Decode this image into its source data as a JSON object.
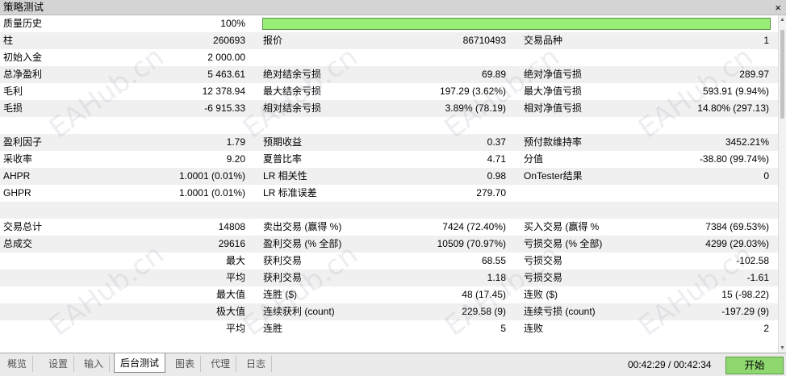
{
  "window": {
    "title": "策略测试",
    "close_glyph": "×"
  },
  "watermark": "EAHub.cn",
  "quality": {
    "label": "质量历史",
    "value": "100%",
    "fraction": 1.0
  },
  "rows": [
    {
      "c1": "柱",
      "v1": "260693",
      "c2": "报价",
      "v2": "86710493",
      "c3": "交易品种",
      "v3": "1"
    },
    {
      "c1": "初始入金",
      "v1": "2 000.00",
      "c2": "",
      "v2": "",
      "c3": "",
      "v3": ""
    },
    {
      "c1": "总净盈利",
      "v1": "5 463.61",
      "c2": "绝对结余亏损",
      "v2": "69.89",
      "c3": "绝对净值亏损",
      "v3": "289.97"
    },
    {
      "c1": "毛利",
      "v1": "12 378.94",
      "c2": "最大结余亏损",
      "v2": "197.29 (3.62%)",
      "c3": "最大净值亏损",
      "v3": "593.91 (9.94%)"
    },
    {
      "c1": "毛损",
      "v1": "-6 915.33",
      "c2": "相对结余亏损",
      "v2": "3.89% (78.19)",
      "c3": "相对净值亏损",
      "v3": "14.80% (297.13)"
    },
    {
      "c1": "",
      "v1": "",
      "c2": "",
      "v2": "",
      "c3": "",
      "v3": ""
    },
    {
      "c1": "盈利因子",
      "v1": "1.79",
      "c2": "预期收益",
      "v2": "0.37",
      "c3": "预付款维持率",
      "v3": "3452.21%"
    },
    {
      "c1": "采收率",
      "v1": "9.20",
      "c2": "夏普比率",
      "v2": "4.71",
      "c3": "分值",
      "v3": "-38.80 (99.74%)"
    },
    {
      "c1": "AHPR",
      "v1": "1.0001 (0.01%)",
      "c2": "LR 相关性",
      "v2": "0.98",
      "c3": "OnTester结果",
      "v3": "0"
    },
    {
      "c1": "GHPR",
      "v1": "1.0001 (0.01%)",
      "c2": "LR 标准误差",
      "v2": "279.70",
      "c3": "",
      "v3": ""
    },
    {
      "c1": "",
      "v1": "",
      "c2": "",
      "v2": "",
      "c3": "",
      "v3": ""
    },
    {
      "c1": "交易总计",
      "v1": "14808",
      "c2": "卖出交易 (赢得 %)",
      "v2": "7424 (72.40%)",
      "c3": "买入交易 (赢得 %",
      "v3": "7384 (69.53%)"
    },
    {
      "c1": "总成交",
      "v1": "29616",
      "c2": "盈利交易 (% 全部)",
      "v2": "10509 (70.97%)",
      "c3": "亏损交易 (% 全部)",
      "v3": "4299 (29.03%)"
    },
    {
      "c1": "",
      "v1": "最大",
      "c2": "获利交易",
      "v2": "68.55",
      "c3": "亏损交易",
      "v3": "-102.58"
    },
    {
      "c1": "",
      "v1": "平均",
      "c2": "获利交易",
      "v2": "1.18",
      "c3": "亏损交易",
      "v3": "-1.61"
    },
    {
      "c1": "",
      "v1": "最大值",
      "c2": "连胜 ($)",
      "v2": "48 (17.45)",
      "c3": "连败 ($)",
      "v3": "15 (-98.22)"
    },
    {
      "c1": "",
      "v1": "极大值",
      "c2": "连续获利 (count)",
      "v2": "229.58 (9)",
      "c3": "连续亏损 (count)",
      "v3": "-197.29 (9)"
    },
    {
      "c1": "",
      "v1": "平均",
      "c2": "连胜",
      "v2": "5",
      "c3": "连败",
      "v3": "2"
    }
  ],
  "tabs": [
    {
      "label": "概览",
      "active": false
    },
    {
      "label": "设置",
      "active": false
    },
    {
      "label": "输入",
      "active": false
    },
    {
      "label": "后台测试",
      "active": true
    },
    {
      "label": "图表",
      "active": false
    },
    {
      "label": "代理",
      "active": false
    },
    {
      "label": "日志",
      "active": false
    }
  ],
  "timer": "00:42:29 / 00:42:34",
  "start_button": "开始",
  "colors": {
    "progress_fill": "#99ee77",
    "start_button": "#8ed86f",
    "alt_row": "#f0f0f0"
  }
}
